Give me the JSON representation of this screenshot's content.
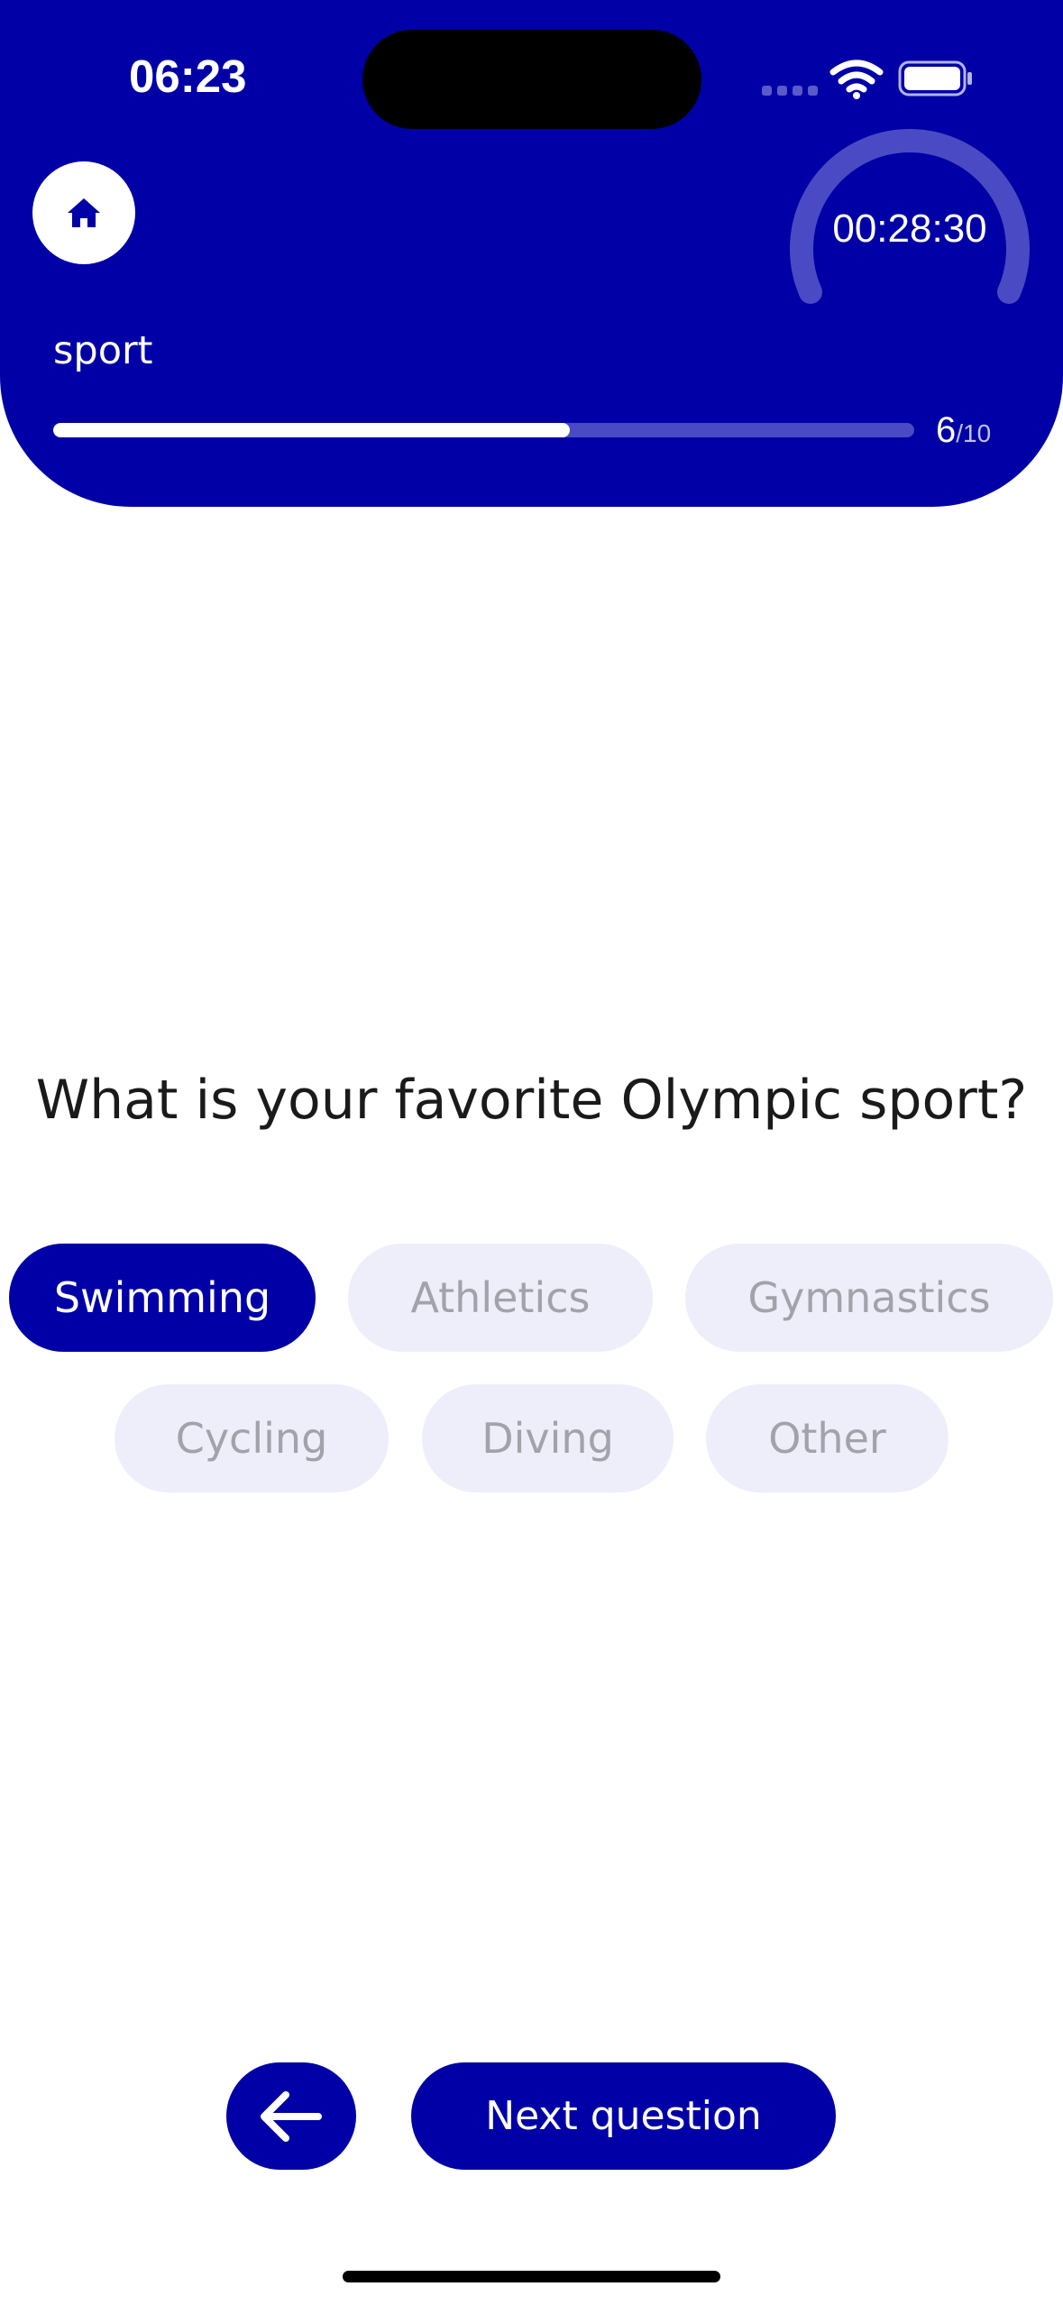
{
  "status_bar": {
    "time": "06:23",
    "icons": [
      "signal-icon",
      "wifi-icon",
      "battery-icon"
    ]
  },
  "header": {
    "home_icon": "home-icon",
    "timer": "00:28:30",
    "category": "sport",
    "progress": {
      "current": "6",
      "total": "/10",
      "fraction": 0.6
    }
  },
  "question": {
    "text": "What is your favorite Olympic sport?",
    "options": [
      {
        "label": "Swimming",
        "selected": true
      },
      {
        "label": "Athletics",
        "selected": false
      },
      {
        "label": "Gymnastics",
        "selected": false
      },
      {
        "label": "Cycling",
        "selected": false
      },
      {
        "label": "Diving",
        "selected": false
      },
      {
        "label": "Other",
        "selected": false
      }
    ]
  },
  "footer": {
    "back_icon": "arrow-left-icon",
    "next_label": "Next question"
  },
  "colors": {
    "primary": "#0000A6",
    "chip_bg": "#EEEEFB",
    "chip_text": "#A2A2AA",
    "white": "#FFFFFF"
  }
}
